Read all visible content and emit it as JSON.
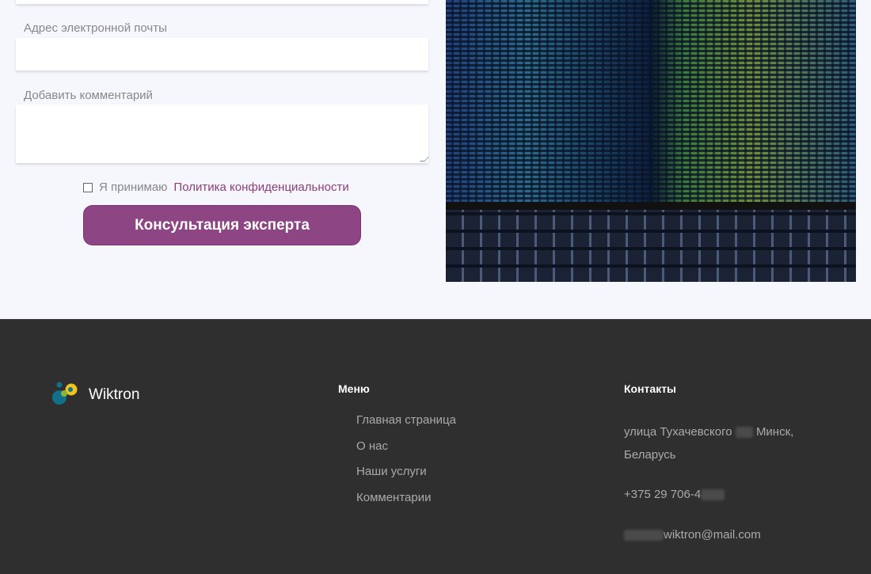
{
  "form": {
    "email_label": "Адрес электронной почты",
    "comment_label": "Добавить комментарий",
    "consent_text": "Я принимаю",
    "privacy_link": "Политика конфиденциальности",
    "submit_label": "Консультация эксперта"
  },
  "footer": {
    "brand": "Wiktron",
    "menu_title": "Меню",
    "menu": [
      "Главная страница",
      "О нас",
      "Наши услуги",
      "Комментарии"
    ],
    "contacts_title": "Контакты",
    "address_1": "улица Тухачевского",
    "address_2": "Минск,",
    "address_3": "Беларусь",
    "phone": "+375 29 706-4",
    "email": "wiktron@mail.com"
  },
  "colors": {
    "accent": "#8e4583",
    "footer_bg": "#2f2f2f",
    "page_bg": "#f6f6fd"
  }
}
